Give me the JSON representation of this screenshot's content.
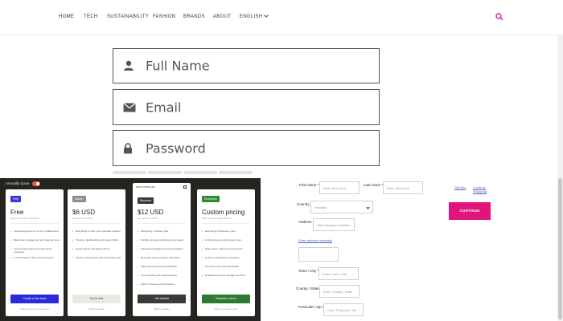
{
  "nav": {
    "items": [
      "HOME",
      "TECH",
      "SUSTAINABILITY",
      "FASHION",
      "BRANDS",
      "ABOUT",
      "ENGLISH"
    ],
    "accent": "#d61fa0"
  },
  "form": {
    "name_label": "Full Name",
    "email_label": "Email",
    "password_label": "Password"
  },
  "pricing": {
    "toggle_label": "Annually (save",
    "plans": [
      {
        "tag": "Free",
        "tag_color": "#3b3bd6",
        "price": "Free",
        "sub": "Forever free for individuals",
        "features": [
          "Unlimited projects for up to 3 collaborators",
          "Basic task management and calendar view",
          "Community support and help center resources",
          "1 GB storage for files and documents"
        ],
        "cta": "Create a free team",
        "cta_bg": "#2b2bd8",
        "cta_fg": "#ffffff",
        "foot": "Always free, no credit card"
      },
      {
        "tag": "Starter",
        "tag_color": "#8d8d8d",
        "price": "$6 USD",
        "sub": "per seat per month",
        "features": [
          "Everything in Free, plus unlimited projects",
          "Timeline, dashboards and custom fields",
          "Guest access and shared forms",
          "Priority email support and onboarding help"
        ],
        "cta": "Try for free",
        "cta_bg": "#e9e9e4",
        "cta_fg": "#333333",
        "foot": "Billed annually"
      },
      {
        "tag": "Business",
        "tag_color": "#3a3a3a",
        "price": "$12 USD",
        "sub": "per seat per month",
        "popular": "MOST POPULAR",
        "features": [
          "Everything in Starter, plus:",
          "Portfolio and goal tracking across teams",
          "Advanced integrations and automations",
          "Reporting across projects and teams",
          "Approvals and proofing workflows",
          "Time tracking and workload views",
          "Admin console and permissions"
        ],
        "cta": "Get started",
        "cta_bg": "#3a3a37",
        "cta_fg": "#ffffff",
        "foot": "Billed annually"
      },
      {
        "tag": "Enterprise",
        "tag_color": "#2f8a2f",
        "price": "Custom pricing",
        "sub": "Built for large organizations",
        "features": [
          "Everything in Business, plus:",
          "Unlimited teams and custom roles",
          "Data export, audit log and retention",
          "Custom branding for workspace",
          "Security review and SSO/SAML",
          "Dedicated success manager and SLA"
        ],
        "cta": "Request a demo",
        "cta_bg": "#2f7a2f",
        "cta_fg": "#ffffff",
        "foot": "Talk to our sales team"
      }
    ]
  },
  "checkout": {
    "first_name_label": "First name *",
    "first_name_placeholder": "Enter first name",
    "last_name_label": "Last name *",
    "last_name_placeholder": "Enter last name",
    "country_label": "Country *",
    "country_value": "Pakistan",
    "address_label": "Address *",
    "address_placeholder": "Start typing an address",
    "manual_link": "Enter address manually",
    "city_label": "Town / City *",
    "city_placeholder": "Enter Town / City",
    "county_label": "County / State",
    "county_placeholder": "Enter County / State",
    "postcode_label": "Postcode / Zip *",
    "postcode_placeholder": "Enter Postcode / Zip",
    "gift_link": "Gift Box",
    "continue_shopping": "Continue Shopping",
    "continue_button": "CONTINUE SECURELY",
    "button_color": "#e0147b"
  }
}
